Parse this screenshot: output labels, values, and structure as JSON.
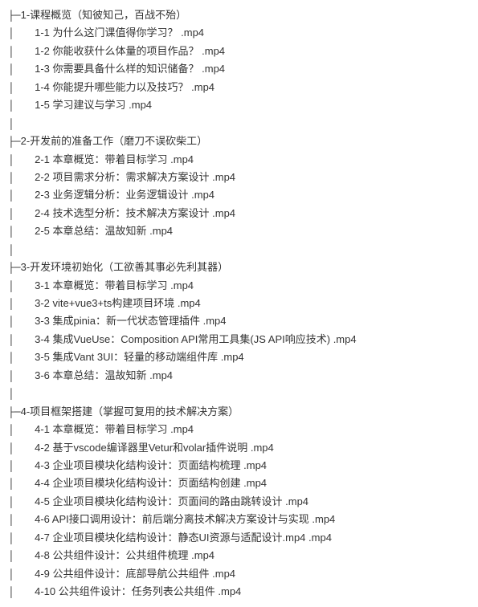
{
  "tree_prefix_chapter": "├",
  "dash": "─",
  "pipe": "│",
  "ext": ".mp4",
  "chapters": [
    {
      "num": "1",
      "title": "课程概览（知彼知己，百战不殆）",
      "items": [
        {
          "num": "1-1",
          "name": "为什么这门课值得你学习？"
        },
        {
          "num": "1-2",
          "name": "你能收获什么体量的项目作品？"
        },
        {
          "num": "1-3",
          "name": "你需要具备什么样的知识储备？"
        },
        {
          "num": "1-4",
          "name": "你能提升哪些能力以及技巧？"
        },
        {
          "num": "1-5",
          "name": "学习建议与学习"
        }
      ]
    },
    {
      "num": "2",
      "title": "开发前的准备工作（磨刀不误砍柴工）",
      "items": [
        {
          "num": "2-1",
          "name": "本章概览：带着目标学习"
        },
        {
          "num": "2-2",
          "name": "项目需求分析：需求解决方案设计"
        },
        {
          "num": "2-3",
          "name": "业务逻辑分析：业务逻辑设计"
        },
        {
          "num": "2-4",
          "name": "技术选型分析：技术解决方案设计"
        },
        {
          "num": "2-5",
          "name": "本章总结：温故知新"
        }
      ]
    },
    {
      "num": "3",
      "title": "开发环境初始化（工欲善其事必先利其器）",
      "items": [
        {
          "num": "3-1",
          "name": "本章概览：带着目标学习"
        },
        {
          "num": "3-2",
          "name": "vite+vue3+ts构建项目环境"
        },
        {
          "num": "3-3",
          "name": "集成pinia：新一代状态管理插件"
        },
        {
          "num": "3-4",
          "name": "集成VueUse：Composition API常用工具集(JS API响应技术)"
        },
        {
          "num": "3-5",
          "name": "集成Vant 3UI：轻量的移动端组件库"
        },
        {
          "num": "3-6",
          "name": "本章总结：温故知新"
        }
      ]
    },
    {
      "num": "4",
      "title": "项目框架搭建（掌握可复用的技术解决方案）",
      "items": [
        {
          "num": "4-1",
          "name": "本章概览：带着目标学习"
        },
        {
          "num": "4-2",
          "name": "基于vscode编译器里Vetur和volar插件说明"
        },
        {
          "num": "4-3",
          "name": "企业项目模块化结构设计：页面结构梳理"
        },
        {
          "num": "4-4",
          "name": "企业项目模块化结构设计：页面结构创建"
        },
        {
          "num": "4-5",
          "name": "企业项目模块化结构设计：页面间的路由跳转设计"
        },
        {
          "num": "4-6",
          "name": "API接口调用设计：前后端分离技术解决方案设计与实现"
        },
        {
          "num": "4-7",
          "name": "企业项目模块化结构设计：静态UI资源与适配设计.mp4"
        },
        {
          "num": "4-8",
          "name": "公共组件设计：公共组件梳理"
        },
        {
          "num": "4-9",
          "name": "公共组件设计：底部导航公共组件"
        },
        {
          "num": "4-10",
          "name": "公共组件设计：任务列表公共组件"
        }
      ]
    }
  ]
}
